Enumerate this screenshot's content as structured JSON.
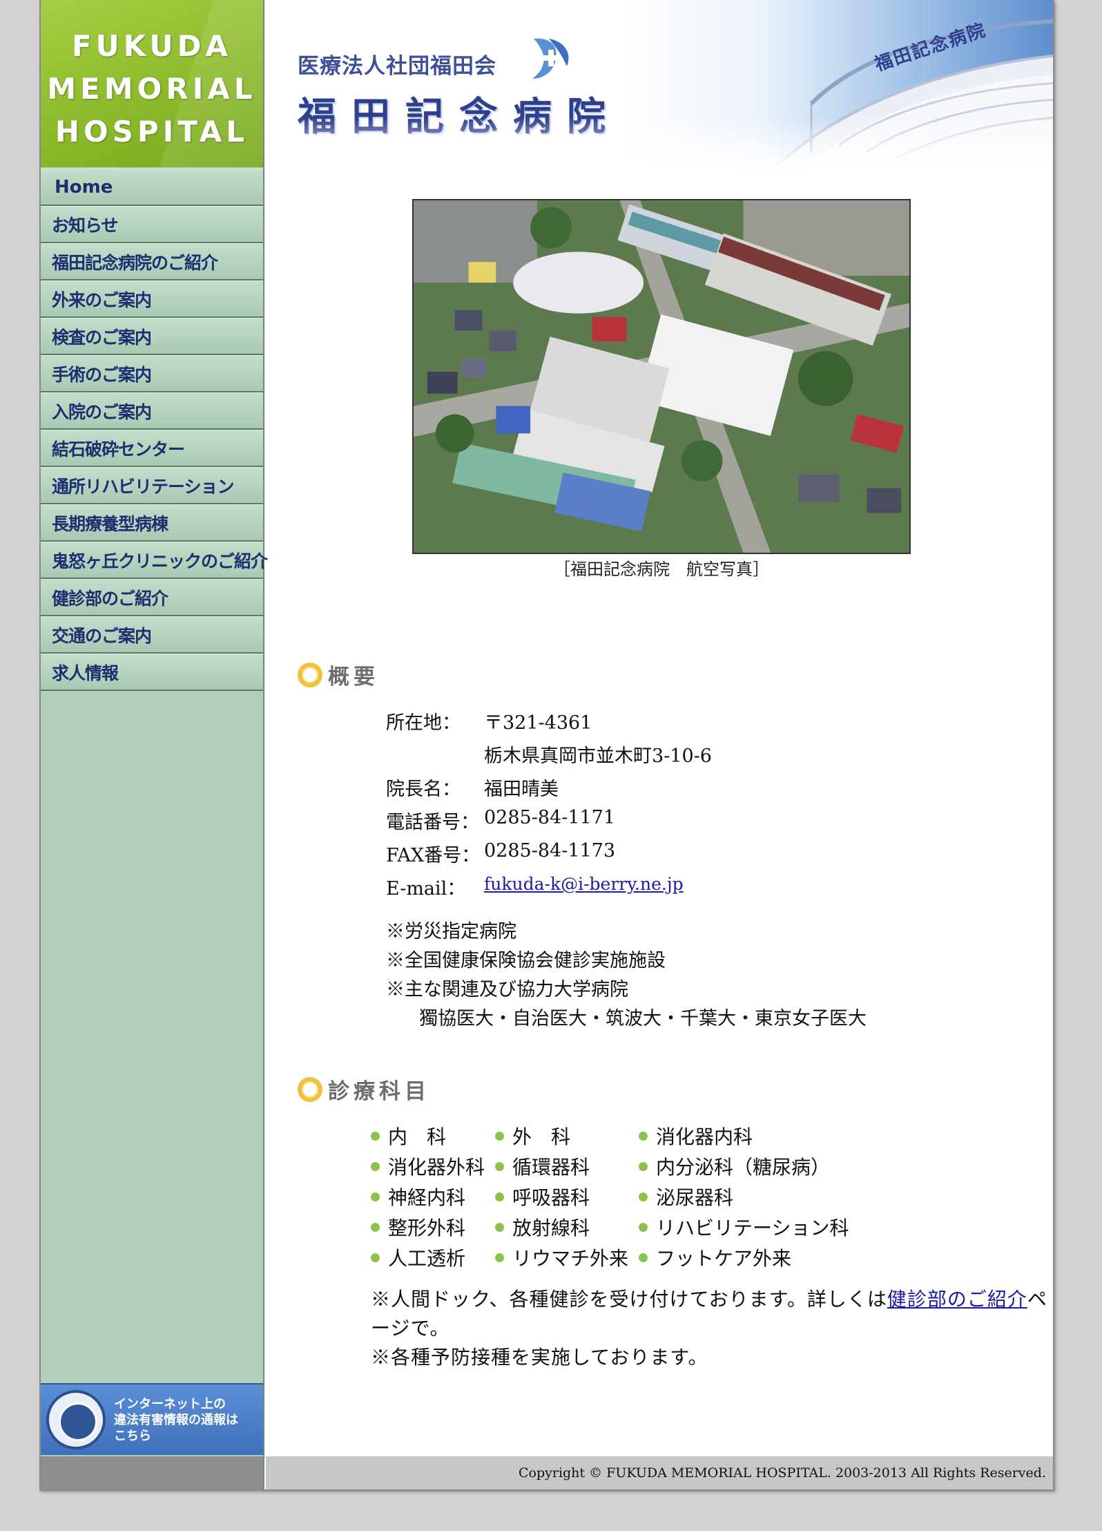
{
  "logo": {
    "text": "FUKUDA\nMEMORIAL\nHOSPITAL"
  },
  "nav": {
    "items": [
      {
        "label": "Home"
      },
      {
        "label": "お知らせ"
      },
      {
        "label": "福田記念病院のご紹介"
      },
      {
        "label": "外来のご案内"
      },
      {
        "label": "検査のご案内"
      },
      {
        "label": "手術のご案内"
      },
      {
        "label": "入院のご案内"
      },
      {
        "label": "結石破砕センター"
      },
      {
        "label": "通所リハビリテーション"
      },
      {
        "label": "長期療養型病棟"
      },
      {
        "label": "鬼怒ヶ丘クリニックのご紹介"
      },
      {
        "label": "健診部のご紹介"
      },
      {
        "label": "交通のご案内"
      },
      {
        "label": "求人情報"
      }
    ]
  },
  "hotline": {
    "text": "インターネット上の\n違法有害情報の通報は\nこちら"
  },
  "header": {
    "org_name": "医療法人社団福田会",
    "hospital_name": "福田記念病院",
    "building_sign": "福田記念病院"
  },
  "photo": {
    "caption": "［福田記念病院　航空写真］"
  },
  "overview": {
    "heading": "概要",
    "rows": [
      {
        "label": "所在地：",
        "value": "〒321-4361"
      },
      {
        "label": "",
        "value": "栃木県真岡市並木町3-10-6"
      },
      {
        "label": "院長名：",
        "value": "福田晴美"
      },
      {
        "label": "電話番号：",
        "value": "0285-84-1171"
      },
      {
        "label": "FAX番号：",
        "value": "0285-84-1173"
      },
      {
        "label": "E-mail：",
        "value": "fukuda-k@i-berry.ne.jp"
      }
    ],
    "notes": [
      "※労災指定病院",
      "※全国健康保険協会健診実施施設",
      "※主な関連及び協力大学病院",
      "獨協医大・自治医大・筑波大・千葉大・東京女子医大"
    ]
  },
  "departments": {
    "heading": "診療科目",
    "items": [
      "内　科",
      "外　科",
      "消化器内科",
      "消化器外科",
      "循環器科",
      "内分泌科（糖尿病）",
      "神経内科",
      "呼吸器科",
      "泌尿器科",
      "整形外科",
      "放射線科",
      "リハビリテーション科",
      "人工透析",
      "リウマチ外来",
      "フットケア外来"
    ],
    "note1_before": "※人間ドック、各種健診を受け付けております。詳しくは",
    "note1_link": "健診部のご紹介",
    "note1_after": "ページで。",
    "note2": "※各種予防接種を実施しております。"
  },
  "footer": {
    "copyright": "Copyright © FUKUDA MEMORIAL HOSPITAL. 2003-2013 All Rights Reserved."
  },
  "colors": {
    "logo_green": "#8cba2c",
    "sidebar_green": "#b2cfbd",
    "nav_text": "#1d2f6e",
    "bullet_green": "#8bc34a",
    "heading_ring": "#f0c23a",
    "link": "#1b1ba8"
  }
}
